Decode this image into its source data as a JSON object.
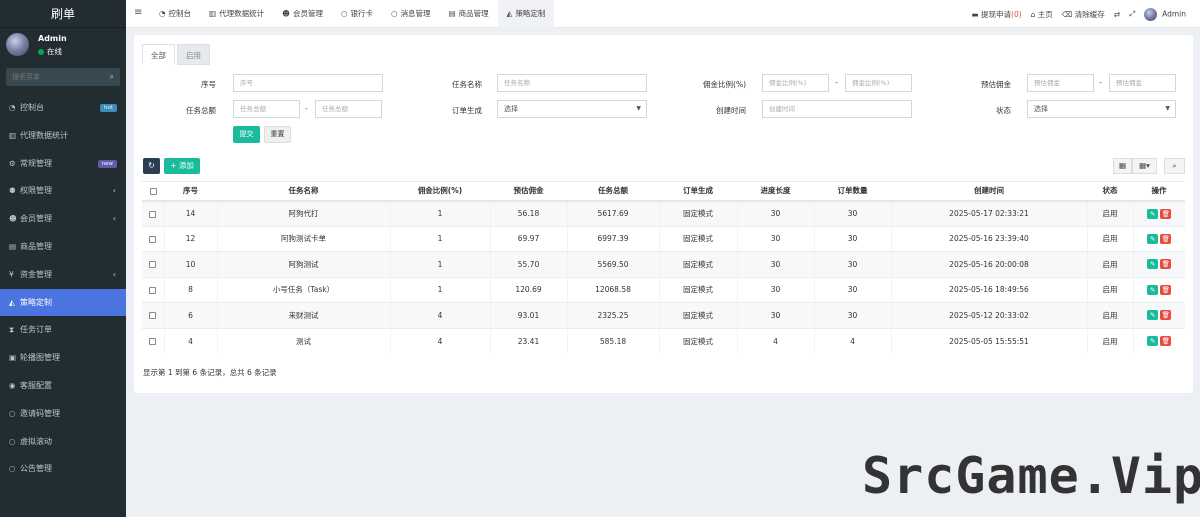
{
  "app": {
    "brand": "刷单",
    "user_name": "Admin",
    "user_status": "在线",
    "search_placeholder": "搜索菜单",
    "accent_color": "#4c74e0",
    "success_color": "#18bc9c",
    "danger_color": "#e74c3c"
  },
  "sidebar": {
    "items": [
      {
        "label": "控制台",
        "icon": "dashboard-icon",
        "badge": "hot"
      },
      {
        "label": "代理数据统计",
        "icon": "bar-chart-icon"
      },
      {
        "label": "常规管理",
        "icon": "cogs-icon",
        "badge": "new"
      },
      {
        "label": "权限管理",
        "icon": "group-icon"
      },
      {
        "label": "会员管理",
        "icon": "user-icon"
      },
      {
        "label": "商品管理",
        "icon": "shop-icon"
      },
      {
        "label": "资金管理",
        "icon": "yen-icon"
      },
      {
        "label": "策略定制",
        "icon": "area-chart-icon",
        "active": true
      },
      {
        "label": "任务订单",
        "icon": "hourglass-icon"
      },
      {
        "label": "轮播图管理",
        "icon": "image-icon"
      },
      {
        "label": "客服配置",
        "icon": "headset-icon"
      },
      {
        "label": "邀请码管理",
        "icon": "circle-icon"
      },
      {
        "label": "虚拟滚动",
        "icon": "circle-icon"
      },
      {
        "label": "公告管理",
        "icon": "circle-icon"
      }
    ]
  },
  "topnav": {
    "tabs": [
      {
        "label": "控制台",
        "icon": "dashboard-icon"
      },
      {
        "label": "代理数据统计",
        "icon": "bar-chart-icon"
      },
      {
        "label": "会员管理",
        "icon": "user-icon"
      },
      {
        "label": "银行卡",
        "icon": "circle-icon"
      },
      {
        "label": "消息管理",
        "icon": "circle-icon"
      },
      {
        "label": "商品管理",
        "icon": "shop-icon"
      },
      {
        "label": "策略定制",
        "icon": "area-chart-icon",
        "active": true
      }
    ],
    "withdraw_label": "提现申请",
    "withdraw_count": "(0)",
    "home_label": "主页",
    "clear_cache_label": "清除缓存",
    "user_label": "Admin"
  },
  "subtabs": [
    "全部",
    "启用"
  ],
  "filters": {
    "id_label": "序号",
    "id_placeholder": "序号",
    "name_label": "任务名称",
    "name_placeholder": "任务名称",
    "ratio_label": "佣金比例(%)",
    "ratio_placeholder": "佣金比例(%)",
    "est_label": "预估佣金",
    "est_placeholder": "预估佣金",
    "total_label": "任务总额",
    "total_placeholder": "任务总额",
    "order_gen_label": "订单生成",
    "order_gen_value": "选择",
    "created_label": "创建时间",
    "created_placeholder": "创建时间",
    "status_label": "状态",
    "status_value": "选择",
    "range_sep": "-",
    "submit_label": "提交",
    "reset_label": "重置"
  },
  "toolbar": {
    "add_label": "添加"
  },
  "table": {
    "columns": [
      "序号",
      "任务名称",
      "佣金比例(%)",
      "预估佣金",
      "任务总额",
      "订单生成",
      "进度长度",
      "订单数量",
      "创建时间",
      "状态",
      "操作"
    ],
    "rows": [
      {
        "id": "14",
        "name": "阿狗代打",
        "ratio": "1",
        "est": "56.18",
        "total": "5617.69",
        "mode": "固定模式",
        "progress": "30",
        "orders": "30",
        "created": "2025-05-17 02:33:21",
        "status": "启用"
      },
      {
        "id": "12",
        "name": "阿狗测试卡单",
        "ratio": "1",
        "est": "69.97",
        "total": "6997.39",
        "mode": "固定模式",
        "progress": "30",
        "orders": "30",
        "created": "2025-05-16 23:39:40",
        "status": "启用"
      },
      {
        "id": "10",
        "name": "阿狗测试",
        "ratio": "1",
        "est": "55.70",
        "total": "5569.50",
        "mode": "固定模式",
        "progress": "30",
        "orders": "30",
        "created": "2025-05-16 20:00:08",
        "status": "启用"
      },
      {
        "id": "8",
        "name": "小号任务（Task）",
        "ratio": "1",
        "est": "120.69",
        "total": "12068.58",
        "mode": "固定模式",
        "progress": "30",
        "orders": "30",
        "created": "2025-05-16 18:49:56",
        "status": "启用"
      },
      {
        "id": "6",
        "name": "来财测试",
        "ratio": "4",
        "est": "93.01",
        "total": "2325.25",
        "mode": "固定模式",
        "progress": "30",
        "orders": "30",
        "created": "2025-05-12 20:33:02",
        "status": "启用"
      },
      {
        "id": "4",
        "name": "测试",
        "ratio": "4",
        "est": "23.41",
        "total": "585.18",
        "mode": "固定模式",
        "progress": "4",
        "orders": "4",
        "created": "2025-05-05 15:55:51",
        "status": "启用"
      }
    ]
  },
  "pagination_text": "显示第 1 到第 6 条记录，总共 6 条记录",
  "watermark": "SrcGame.Vip"
}
